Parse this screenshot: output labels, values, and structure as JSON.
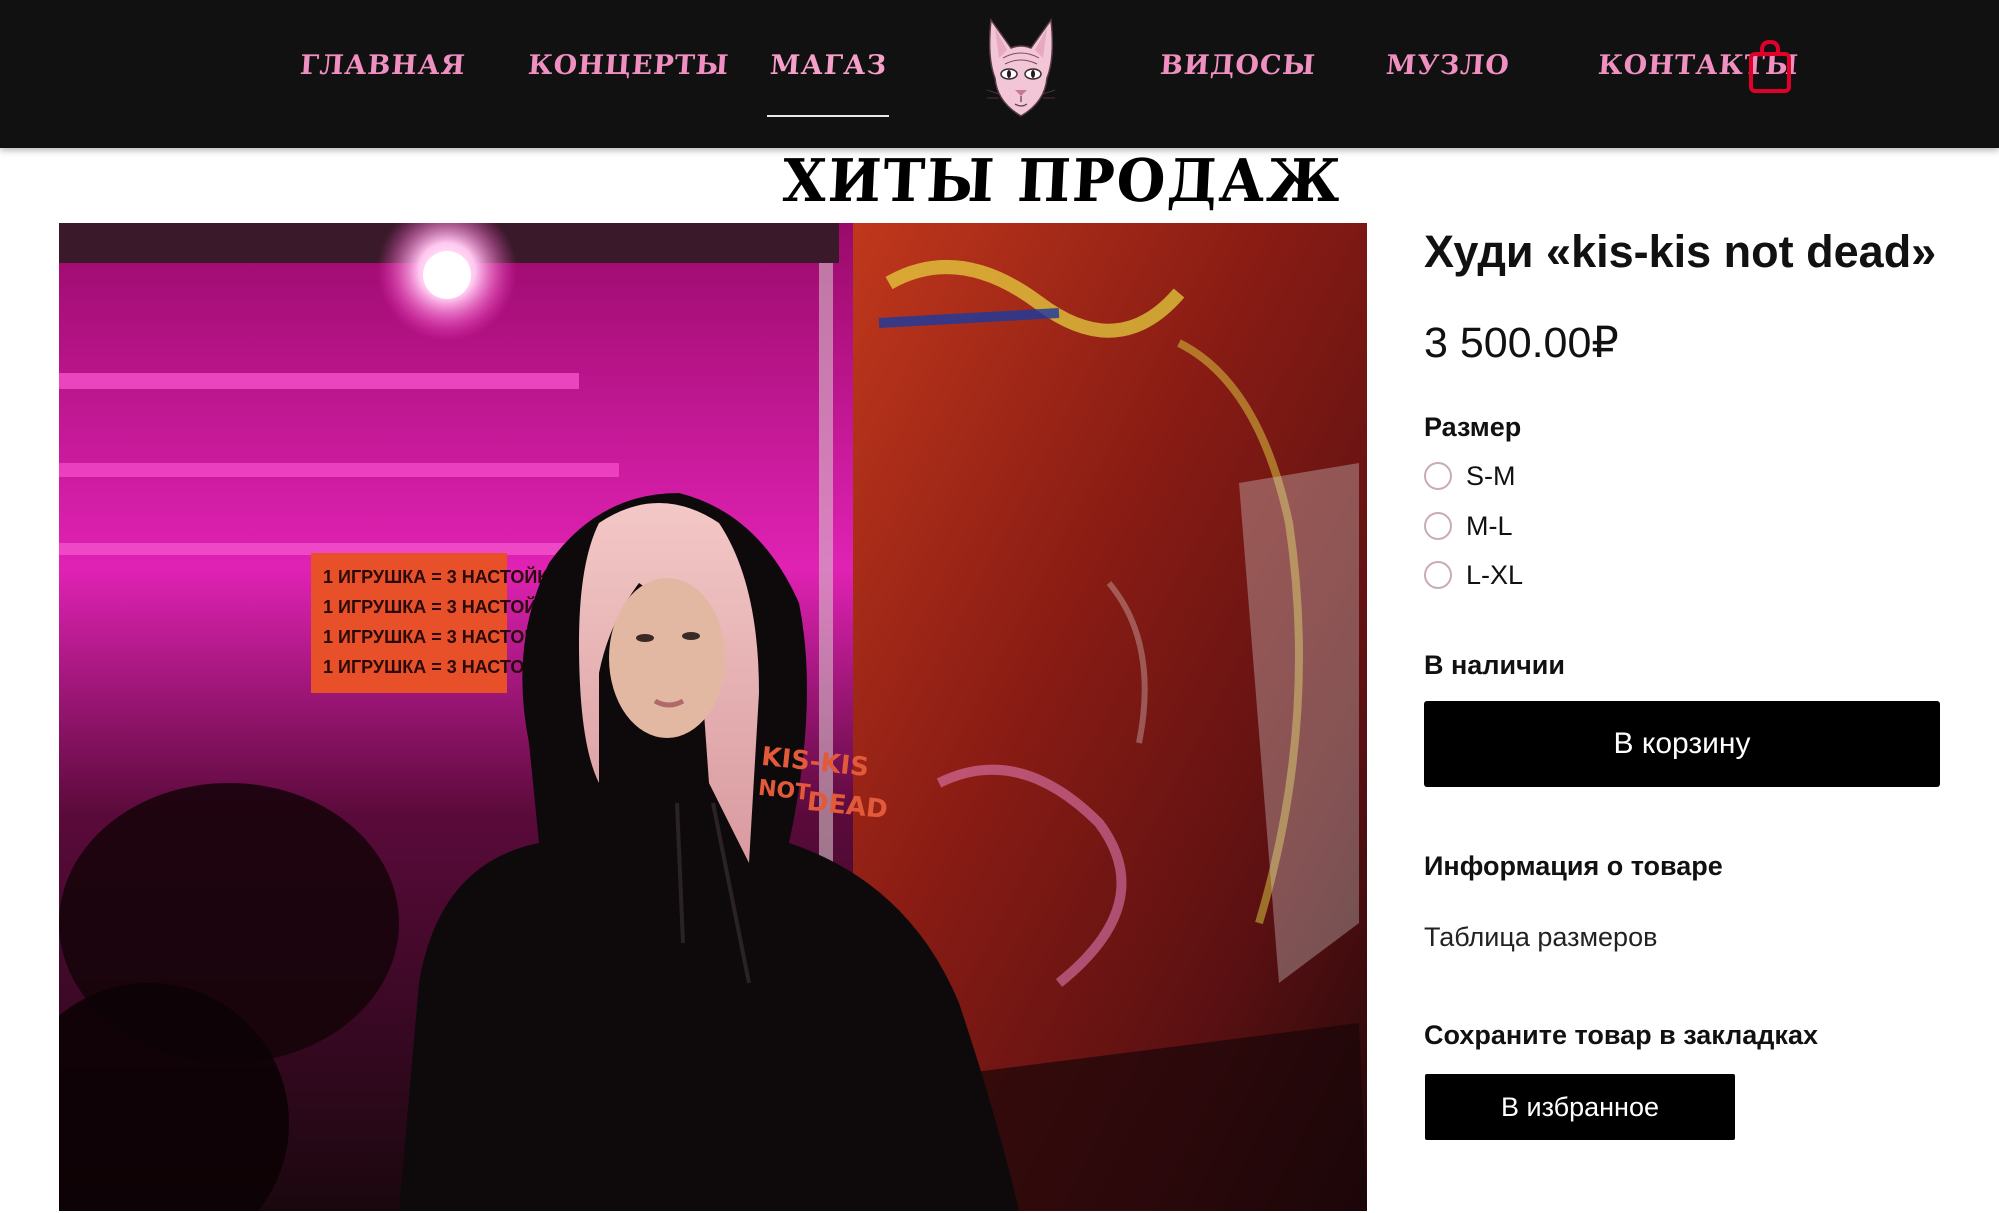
{
  "nav": {
    "items": [
      {
        "label": "ГЛАВНАЯ"
      },
      {
        "label": "КОНЦЕРТЫ"
      },
      {
        "label": "МАГАЗ"
      },
      {
        "label": "ВИДОСЫ"
      },
      {
        "label": "МУЗЛО"
      },
      {
        "label": "КОНТАКТЫ"
      }
    ],
    "active": "МАГАЗ",
    "logo_icon": "sphynx-cat-logo",
    "cart_icon": "shopping-bag-icon",
    "link_color": "#f090c0",
    "cart_color": "#e0002a"
  },
  "section": {
    "title": "ХИТЫ ПРОДАЖ"
  },
  "product": {
    "image_text": {
      "hoodie_print": [
        "KIS-KIS",
        "NOT",
        "DEAD"
      ],
      "sign_line": "1 ИГРУШКА = 3 НАСТОЙКИ!"
    },
    "title": "Худи «kis-kis not dead»",
    "price": "3 500.00₽",
    "size_label": "Размер",
    "sizes": [
      {
        "label": "S-M"
      },
      {
        "label": "M-L"
      },
      {
        "label": "L-XL"
      }
    ],
    "stock": "В наличии",
    "add_to_cart": "В корзину",
    "info_title": "Информация о товаре",
    "size_table": "Таблица размеров",
    "bookmark_title": "Сохраните товар в закладках",
    "favorite_button": "В избранное"
  }
}
